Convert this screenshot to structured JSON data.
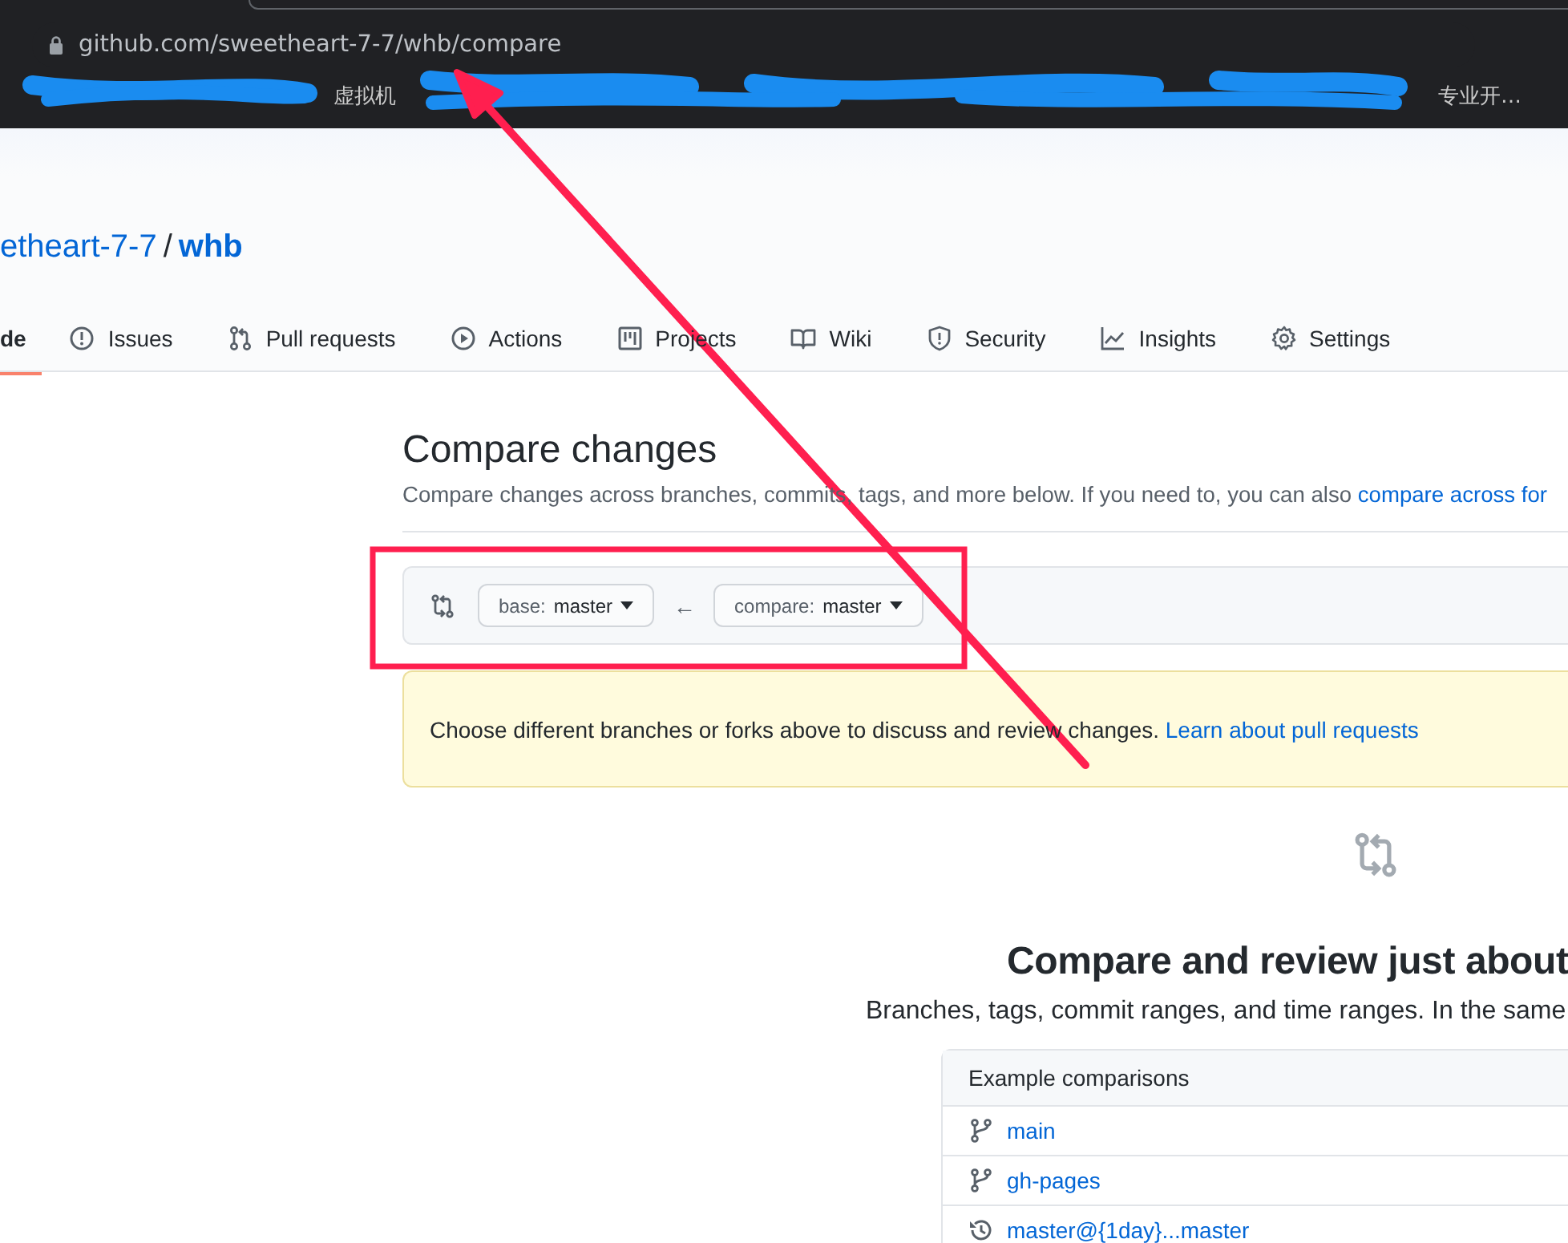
{
  "browser": {
    "url": "github.com/sweetheart-7-7/whb/compare",
    "bookmarks": [
      "虚拟机",
      "专业开…"
    ],
    "bookmarks_redacted": true
  },
  "repo": {
    "owner": "etheart-7-7",
    "separator": "/",
    "name": "whb"
  },
  "tabs": [
    {
      "label": "de",
      "selected": true
    },
    {
      "label": "Issues",
      "selected": false
    },
    {
      "label": "Pull requests",
      "selected": false
    },
    {
      "label": "Actions",
      "selected": false
    },
    {
      "label": "Projects",
      "selected": false
    },
    {
      "label": "Wiki",
      "selected": false
    },
    {
      "label": "Security",
      "selected": false
    },
    {
      "label": "Insights",
      "selected": false
    },
    {
      "label": "Settings",
      "selected": false
    }
  ],
  "compare": {
    "title": "Compare changes",
    "subtitle": "Compare changes across branches, commits, tags, and more below. If you need to, you can also ",
    "subtitle_link": "compare across for",
    "base": {
      "prefix": "base:",
      "branch": "master"
    },
    "arrow": "←",
    "head": {
      "prefix": "compare:",
      "branch": "master"
    },
    "notice": "Choose different branches or forks above to discuss and review changes.",
    "notice_link": "Learn about pull requests"
  },
  "blankslate": {
    "title": "Compare and review just about",
    "text": "Branches, tags, commit ranges, and time ranges. In the same"
  },
  "examples": {
    "header": "Example comparisons",
    "rows": [
      {
        "kind": "branch",
        "label": "main"
      },
      {
        "kind": "branch",
        "label": "gh-pages"
      },
      {
        "kind": "history",
        "label": "master@{1day}...master"
      }
    ]
  },
  "annotations": {
    "arrow": true,
    "highlight_box": true
  }
}
